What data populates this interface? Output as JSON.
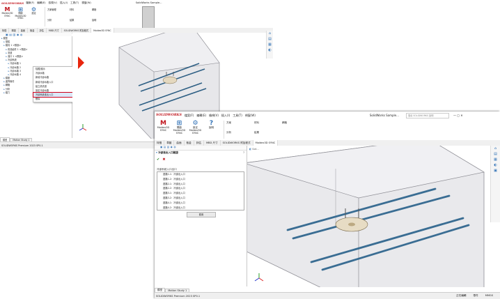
{
  "brand": {
    "logo": "SOLIDWORKS",
    "accent": "#c0141c"
  },
  "window1": {
    "menu": [
      "檔案(F)",
      "編輯(E)",
      "檢視(V)",
      "插入(I)",
      "工具(T)",
      "視窗(W)"
    ],
    "title": "SolidWorks Sample...",
    "ribbon": [
      {
        "icon": "M",
        "label": "Moldex3D SYNC"
      },
      {
        "icon": "⊞",
        "label": "開啟 Moldex3D SYNC"
      },
      {
        "icon": "⚙",
        "label": "設定"
      }
    ],
    "ribbon_right": [
      "方案管理",
      "材料",
      "網格",
      "分析",
      "結果",
      "說明"
    ],
    "tabs": [
      "特徵",
      "草圖",
      "曲面",
      "鈑金",
      "評估",
      "MBD 尺寸",
      "SOLIDWORKS 附加程式",
      "Moldex3D SYNC"
    ],
    "tree": [
      "模型",
      "  型腔",
      "  模具 1 <預設>",
      "    成品組件 1 <預設>",
      "    流道",
      "    澆口 1 <預設>",
      "    冷卻系統",
      "      冷卻水路 1",
      "      冷卻水路 2",
      "      冷卻水路 3",
      "      冷卻水路 4",
      "  模座",
      "  邊界條件",
      "  網格",
      "  分析",
      "  模穴"
    ],
    "context_menu": [
      "隱藏/顯示",
      "冷卻水路",
      "新增冷卻水路",
      "新增冷卻水路入口",
      "建立熱流道",
      "設定冷卻水路",
      "冷卻系統進出入口",
      "刪除"
    ],
    "context_highlight_index": 6,
    "bottom_tabs": [
      "模型",
      "Motion Study 1"
    ],
    "status": "SOLIDWORKS Premium 2023 SP0.1"
  },
  "window2": {
    "menu": [
      "檔案(F)",
      "編輯(E)",
      "檢視(V)",
      "插入(I)",
      "工具(T)",
      "視窗(W)"
    ],
    "title": "SolidWorks Sample...",
    "search_placeholder": "搜尋 SOLIDWORKS 說明",
    "ribbon": [
      {
        "icon": "M",
        "label": "Moldex3D SYNC"
      },
      {
        "icon": "⊞",
        "label": "開啟 Moldex3D SYNC"
      },
      {
        "icon": "⚙",
        "label": "設定 Moldex3D SYNC"
      },
      {
        "icon": "?",
        "label": "說明"
      }
    ],
    "ribbon_right": [
      "方案",
      "材料",
      "網格",
      "分析",
      "結果"
    ],
    "tabs": [
      "特徵",
      "草圖",
      "曲面",
      "鈑金",
      "評估",
      "MBD 尺寸",
      "SOLIDWORKS 附加程式",
      "Moldex3D SYNC"
    ],
    "panel_title": "冷卻進出入口驗證",
    "panel_section": "冷卻系統入口出口",
    "list_items": [
      "迴路1-1：冷卻出入口",
      "迴路1-2：冷卻出入口",
      "迴路2-1：冷卻出入口",
      "迴路2-2：冷卻出入口",
      "迴路3-1：冷卻出入口",
      "迴路3-2：冷卻出入口",
      "迴路4-1：冷卻出入口",
      "迴路4-2：冷卻出入口"
    ],
    "apply_button": "套用",
    "bottom_tabs": [
      "模型",
      "Motion Study 1"
    ],
    "status": "SOLIDWORKS Premium 2023 SP0.1",
    "status_right": [
      "正在編輯",
      "零件",
      "MMGS"
    ]
  }
}
